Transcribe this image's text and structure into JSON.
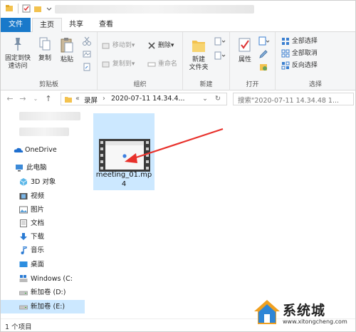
{
  "ribbon_tabs": {
    "file": "文件",
    "home": "主页",
    "share": "共享",
    "view": "查看"
  },
  "clipboard": {
    "pin_label": "固定到快\n速访问",
    "copy_label": "复制",
    "paste_label": "粘贴",
    "group_label": "剪贴板"
  },
  "organize": {
    "move_to": "移动到▾",
    "copy_to": "复制到▾",
    "delete": "删除▾",
    "rename": "重命名",
    "group_label": "组织"
  },
  "new_group": {
    "new_folder": "新建\n文件夹",
    "group_label": "新建"
  },
  "open_group": {
    "properties": "属性",
    "group_label": "打开"
  },
  "select_group": {
    "select_all": "全部选择",
    "select_none": "全部取消",
    "invert": "反向选择",
    "group_label": "选择"
  },
  "address": {
    "chevron": "«",
    "crumb1": "录屏",
    "crumb2": "2020-07-11 14.34.4...",
    "sep": "›"
  },
  "search": {
    "placeholder": "搜索\"2020-07-11 14.34.48 1..."
  },
  "nav": {
    "onedrive": "OneDrive",
    "this_pc": "此电脑",
    "objects3d": "3D 对象",
    "videos": "视频",
    "pictures": "图片",
    "documents": "文档",
    "downloads": "下载",
    "music": "音乐",
    "desktop": "桌面",
    "windows_c": "Windows (C:",
    "drive_d": "新加卷 (D:)",
    "drive_e": "新加卷 (E:)"
  },
  "file": {
    "name": "meeting_01.mp\n4"
  },
  "status": {
    "count": "1 个项目",
    "selected": ""
  },
  "watermark": {
    "line1": "系统城",
    "line2": "www.xitongcheng.com"
  },
  "colors": {
    "accent": "#1979ca",
    "selection": "#cce8ff",
    "arrow": "#e8312b"
  }
}
